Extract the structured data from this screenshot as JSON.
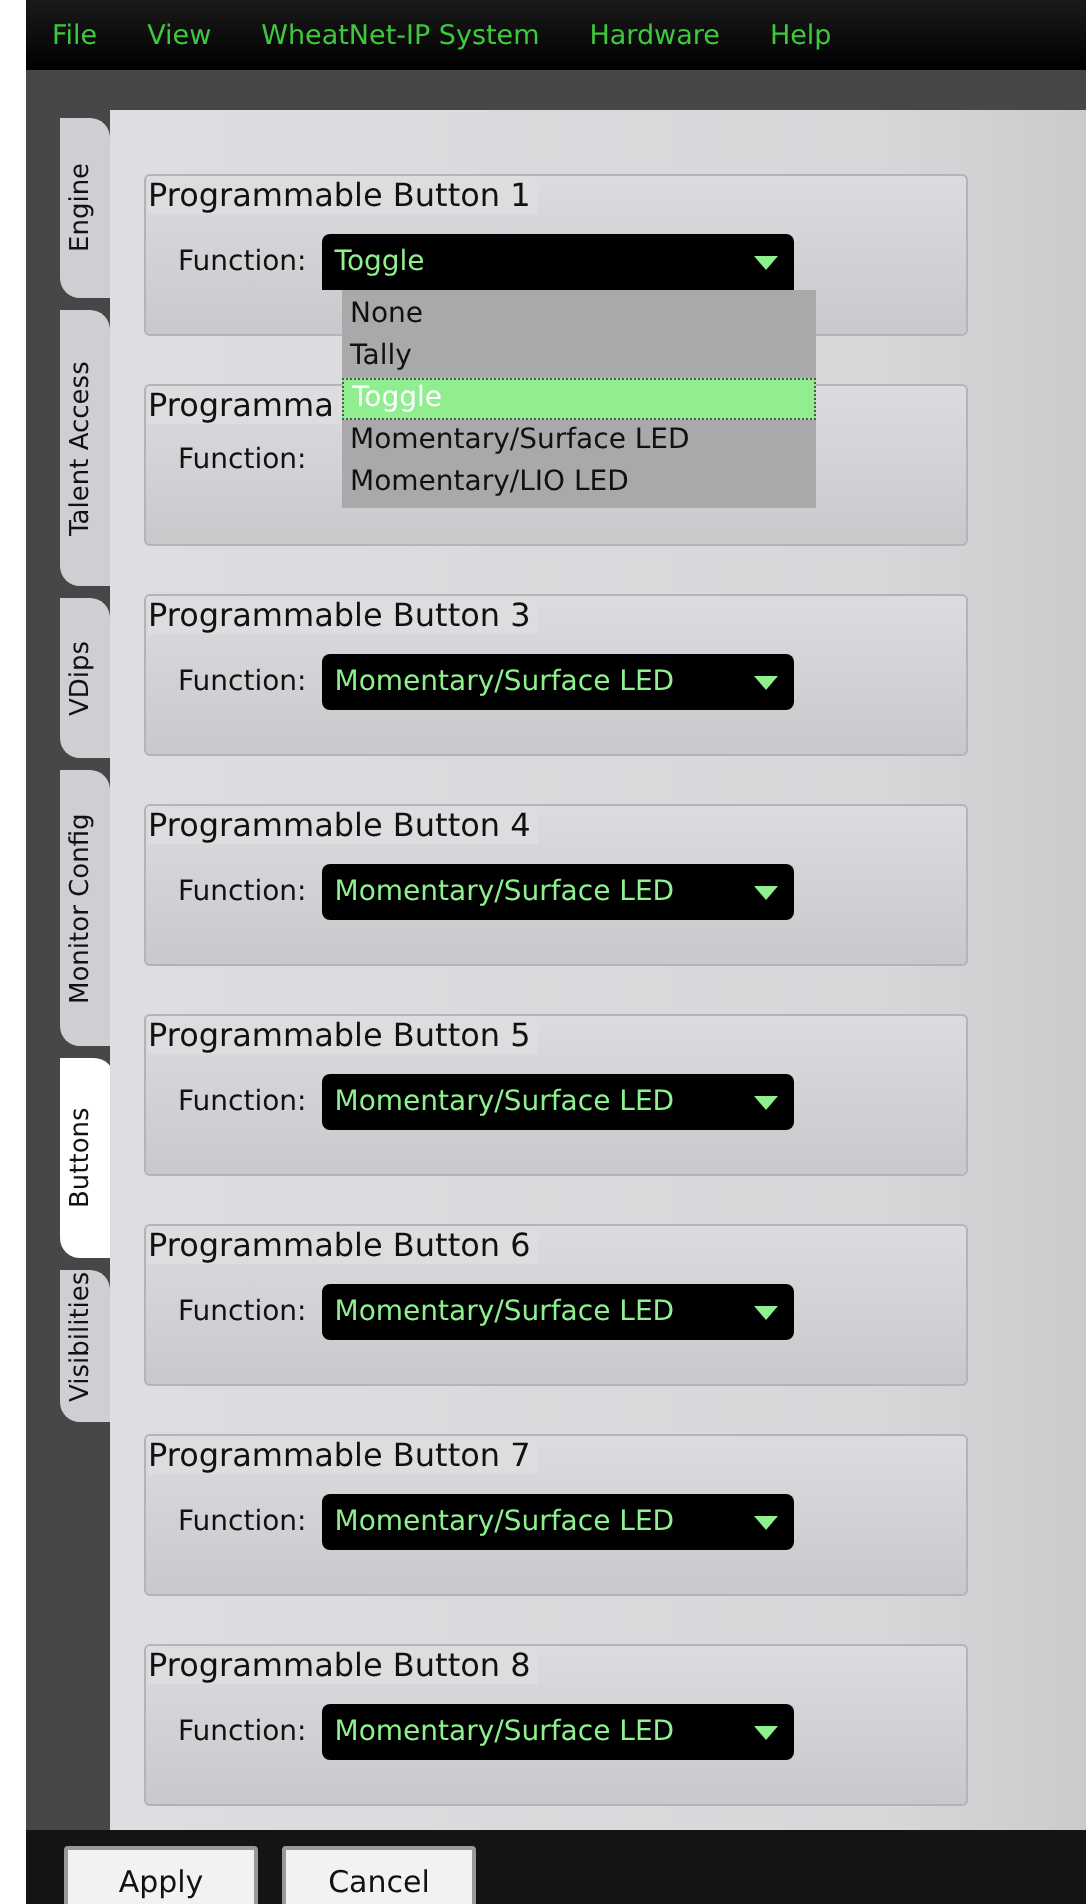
{
  "menu": [
    {
      "label": "File"
    },
    {
      "label": "View"
    },
    {
      "label": "WheatNet-IP System"
    },
    {
      "label": "Hardware"
    },
    {
      "label": "Help"
    }
  ],
  "tabs": [
    {
      "label": "Engine",
      "selected": false
    },
    {
      "label": "Talent Access",
      "selected": false
    },
    {
      "label": "VDips",
      "selected": false
    },
    {
      "label": "Monitor Config",
      "selected": false
    },
    {
      "label": "Buttons",
      "selected": true
    },
    {
      "label": "Visibilities",
      "selected": false
    }
  ],
  "groups": [
    {
      "title": "Programmable Button 1",
      "function_label": "Function:",
      "value": "Toggle",
      "open": true,
      "options": [
        {
          "label": "None",
          "selected": false
        },
        {
          "label": "Tally",
          "selected": false
        },
        {
          "label": "Toggle",
          "selected": true
        },
        {
          "label": "Momentary/Surface LED",
          "selected": false
        },
        {
          "label": "Momentary/LIO LED",
          "selected": false
        }
      ]
    },
    {
      "title": "Programma",
      "function_label": "Function:"
    },
    {
      "title": "Programmable Button 3",
      "function_label": "Function:",
      "value": "Momentary/Surface LED",
      "open": false
    },
    {
      "title": "Programmable Button 4",
      "function_label": "Function:",
      "value": "Momentary/Surface LED",
      "open": false
    },
    {
      "title": "Programmable Button 5",
      "function_label": "Function:",
      "value": "Momentary/Surface LED",
      "open": false
    },
    {
      "title": "Programmable Button 6",
      "function_label": "Function:",
      "value": "Momentary/Surface LED",
      "open": false
    },
    {
      "title": "Programmable Button 7",
      "function_label": "Function:",
      "value": "Momentary/Surface LED",
      "open": false
    },
    {
      "title": "Programmable Button 8",
      "function_label": "Function:",
      "value": "Momentary/Surface LED",
      "open": false
    }
  ],
  "buttons": [
    {
      "label": "Apply"
    },
    {
      "label": "Cancel"
    }
  ]
}
